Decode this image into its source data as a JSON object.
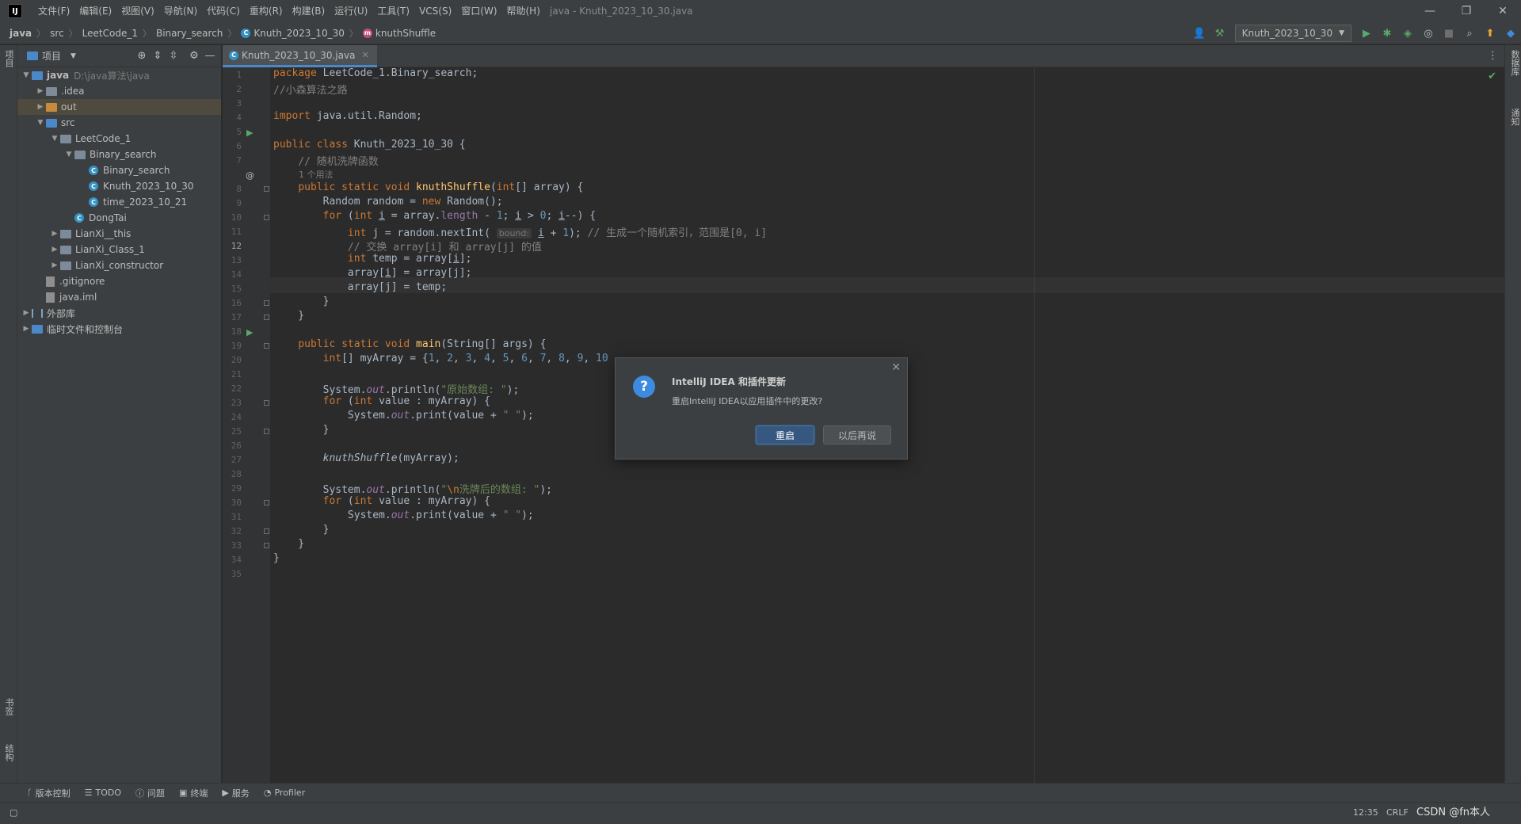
{
  "menu": {
    "items": [
      "文件(F)",
      "编辑(E)",
      "视图(V)",
      "导航(N)",
      "代码(C)",
      "重构(R)",
      "构建(B)",
      "运行(U)",
      "工具(T)",
      "VCS(S)",
      "窗口(W)",
      "帮助(H)"
    ],
    "window_title": "java - Knuth_2023_10_30.java"
  },
  "breadcrumb": {
    "items": [
      "java",
      "src",
      "LeetCode_1",
      "Binary_search",
      "Knuth_2023_10_30",
      "knuthShuffle"
    ]
  },
  "toolbar": {
    "run_config": "Knuth_2023_10_30"
  },
  "project": {
    "title": "项目",
    "tree": [
      {
        "label": "java",
        "hint": "D:\\java算法\\java",
        "arrow": "v",
        "icon": "folder-blue",
        "depth": 0
      },
      {
        "label": ".idea",
        "arrow": ">",
        "icon": "folder",
        "depth": 1
      },
      {
        "label": "out",
        "arrow": ">",
        "icon": "folder-orange",
        "depth": 1
      },
      {
        "label": "src",
        "arrow": "v",
        "icon": "folder-blue",
        "depth": 1
      },
      {
        "label": "LeetCode_1",
        "arrow": "v",
        "icon": "folder",
        "depth": 2
      },
      {
        "label": "Binary_search",
        "arrow": "v",
        "icon": "folder",
        "depth": 3
      },
      {
        "label": "Binary_search",
        "arrow": "",
        "icon": "class",
        "depth": 4
      },
      {
        "label": "Knuth_2023_10_30",
        "arrow": "",
        "icon": "class",
        "depth": 4
      },
      {
        "label": "time_2023_10_21",
        "arrow": "",
        "icon": "class",
        "depth": 4
      },
      {
        "label": "DongTai",
        "arrow": "",
        "icon": "class",
        "depth": 3
      },
      {
        "label": "LianXi__this",
        "arrow": ">",
        "icon": "folder",
        "depth": 2
      },
      {
        "label": "LianXi_Class_1",
        "arrow": ">",
        "icon": "folder",
        "depth": 2
      },
      {
        "label": "LianXi_constructor",
        "arrow": ">",
        "icon": "folder",
        "depth": 2
      },
      {
        "label": ".gitignore",
        "arrow": "",
        "icon": "file",
        "depth": 1
      },
      {
        "label": "java.iml",
        "arrow": "",
        "icon": "file",
        "depth": 1
      },
      {
        "label": "外部库",
        "arrow": ">",
        "icon": "library",
        "depth": 0
      },
      {
        "label": "临时文件和控制台",
        "arrow": ">",
        "icon": "scratch",
        "depth": 0
      }
    ]
  },
  "editor": {
    "tab_label": "Knuth_2023_10_30.java",
    "current_line": 12,
    "usage_hint": "1 个用法",
    "inlay_hint": "bound:",
    "line_count": 35
  },
  "left_strip": {
    "project_label": "项目",
    "bookmarks_label": "书签",
    "structure_label": "结构"
  },
  "right_strip": {
    "database_label": "数据库",
    "notifications_label": "通知"
  },
  "bottom_tools": [
    "版本控制",
    "TODO",
    "问题",
    "终端",
    "服务",
    "Profiler"
  ],
  "status": {
    "position": "12:35",
    "line_sep": "CRLF",
    "watermark": "CSDN @fn本人"
  },
  "dialog": {
    "title": "IntelliJ IDEA 和插件更新",
    "message": "重启IntelliJ IDEA以应用插件中的更改?",
    "primary_button": "重启",
    "secondary_button": "以后再说"
  },
  "colors": {
    "keyword": "#cc7832",
    "number": "#6897bb",
    "string": "#6a8759",
    "comment": "#808080",
    "function": "#ffc66d",
    "field": "#9876aa",
    "accent": "#365880"
  }
}
